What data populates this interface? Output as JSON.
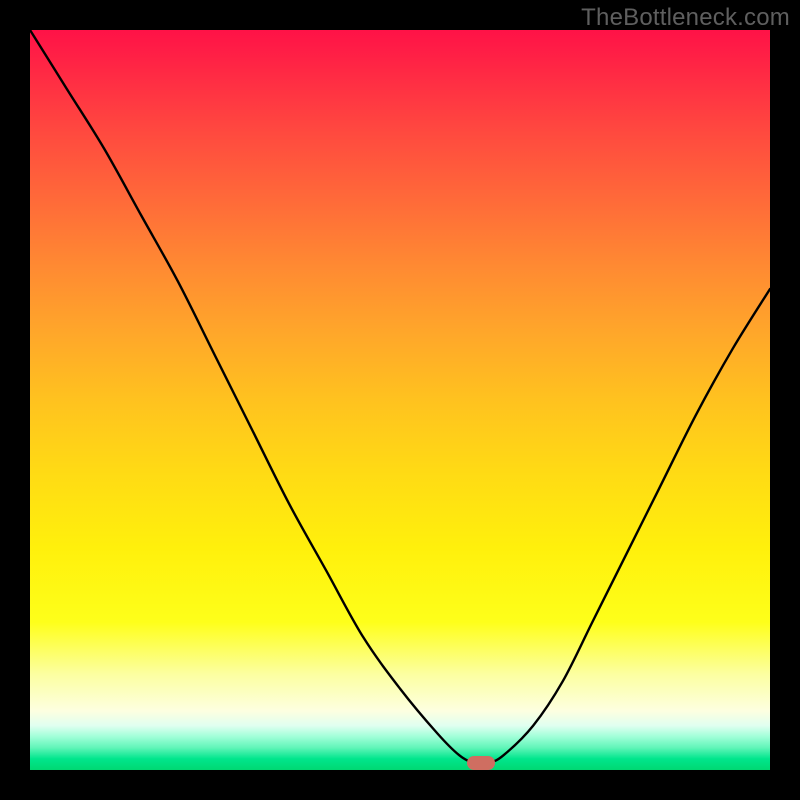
{
  "watermark": "TheBottleneck.com",
  "colors": {
    "frame_background": "#000000",
    "curve_stroke": "#000000",
    "marker_fill": "#cf6e61",
    "watermark_color": "#5f5f5f",
    "gradient_top": "#ff1247",
    "gradient_bottom": "#00d872"
  },
  "chart_data": {
    "type": "line",
    "title": "",
    "xlabel": "",
    "ylabel": "",
    "xlim": [
      0,
      100
    ],
    "ylim": [
      0,
      100
    ],
    "grid": false,
    "legend": false,
    "series": [
      {
        "name": "bottleneck-curve",
        "x": [
          0,
          5,
          10,
          15,
          20,
          25,
          30,
          35,
          40,
          45,
          50,
          55,
          58,
          60,
          62,
          64,
          68,
          72,
          76,
          80,
          85,
          90,
          95,
          100
        ],
        "y": [
          100,
          92,
          84,
          75,
          66,
          56,
          46,
          36,
          27,
          18,
          11,
          5,
          2,
          1,
          1,
          2,
          6,
          12,
          20,
          28,
          38,
          48,
          57,
          65
        ]
      }
    ],
    "marker": {
      "x": 61,
      "y": 1
    },
    "annotations": []
  }
}
